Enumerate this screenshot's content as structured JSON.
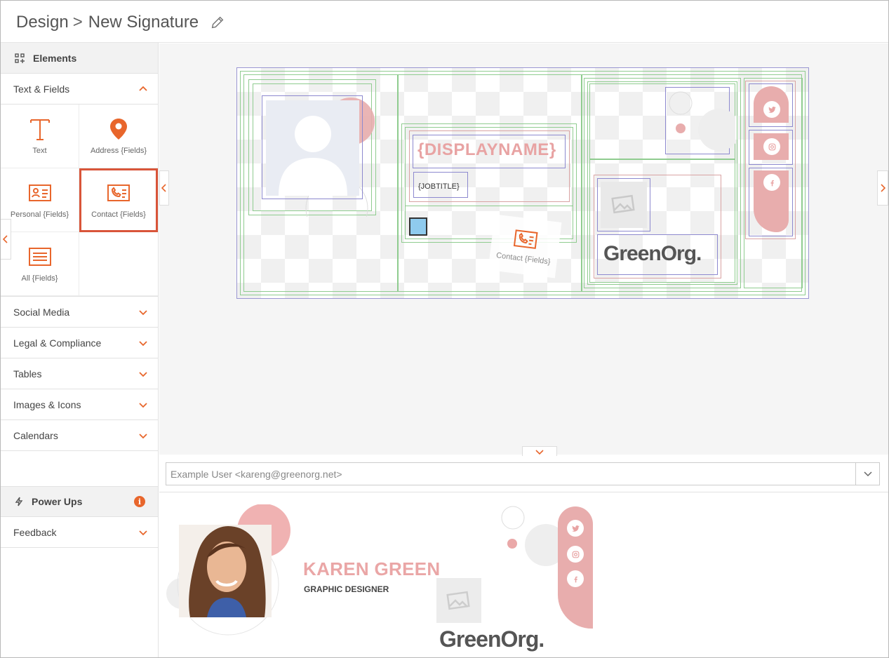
{
  "header": {
    "crumb_root": "Design",
    "crumb_sep": ">",
    "title": "New Signature"
  },
  "sidebar": {
    "elements_label": "Elements",
    "sections": {
      "text_fields": "Text & Fields",
      "social_media": "Social Media",
      "legal": "Legal & Compliance",
      "tables": "Tables",
      "images_icons": "Images & Icons",
      "calendars": "Calendars",
      "power_ups": "Power Ups",
      "feedback": "Feedback"
    },
    "tiles": {
      "text": "Text",
      "address": "Address {Fields}",
      "personal": "Personal {Fields}",
      "contact": "Contact {Fields}",
      "all": "All {Fields}"
    }
  },
  "canvas": {
    "displayname": "{DISPLAYNAME}",
    "jobtitle": "{JOBTITLE}",
    "drag_label": "Contact {Fields}",
    "logo": "GreenOrg."
  },
  "preview_select": {
    "value": "Example User <kareng@greenorg.net>"
  },
  "preview": {
    "name": "KAREN GREEN",
    "role": "GRAPHIC DESIGNER",
    "logo": "GreenOrg."
  },
  "colors": {
    "accent": "#e8662c",
    "selection": "#d9553a",
    "pink": "#e8adad",
    "guide_green": "#8fcc8f",
    "guide_purple": "#8d89cf"
  },
  "icons": [
    "pencil-icon",
    "elements-icon",
    "chevron-up-icon",
    "chevron-down-icon",
    "text-icon",
    "map-pin-icon",
    "id-card-icon",
    "contact-card-icon",
    "list-icon",
    "lightning-icon",
    "info-icon",
    "twitter-icon",
    "instagram-icon",
    "facebook-icon",
    "image-placeholder-icon",
    "avatar-placeholder-icon"
  ]
}
